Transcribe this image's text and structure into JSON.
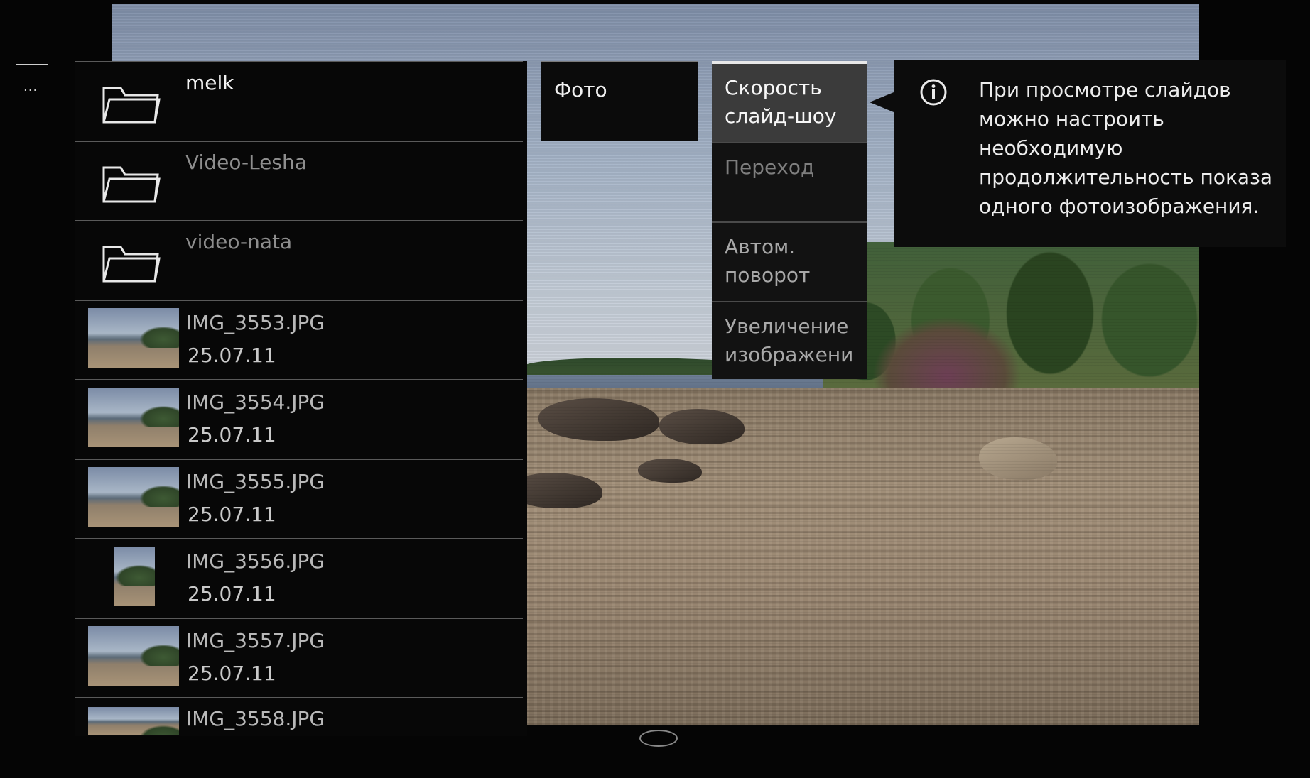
{
  "category": {
    "label": "Фото"
  },
  "files": [
    {
      "type": "folder",
      "name": "melk",
      "date": ""
    },
    {
      "type": "folder",
      "name": "Video-Lesha",
      "date": ""
    },
    {
      "type": "folder",
      "name": "video-nata",
      "date": ""
    },
    {
      "type": "image",
      "name": "IMG_3553.JPG",
      "date": "25.07.11"
    },
    {
      "type": "image",
      "name": "IMG_3554.JPG",
      "date": "25.07.11"
    },
    {
      "type": "image",
      "name": "IMG_3555.JPG",
      "date": "25.07.11"
    },
    {
      "type": "image",
      "name": "IMG_3556.JPG",
      "date": "25.07.11"
    },
    {
      "type": "image",
      "name": "IMG_3557.JPG",
      "date": "25.07.11"
    },
    {
      "type": "image",
      "name": "IMG_3558.JPG",
      "date": ""
    }
  ],
  "settings_menu": {
    "items": [
      {
        "label": "Скорость слайд-шоу"
      },
      {
        "label": "Переход"
      },
      {
        "label": "Автом. поворот"
      },
      {
        "label": "Увеличение изображени"
      }
    ]
  },
  "tooltip": {
    "icon": "info-icon",
    "text": "При просмотре слайдов можно настроить необходимую продолжительность показа одного фотоизображения."
  },
  "side": {
    "indicator": "..."
  },
  "colors": {
    "background": "#050505",
    "panel": "#121212",
    "active_item": "#3b3b3b",
    "text": "#e6e6e6"
  }
}
